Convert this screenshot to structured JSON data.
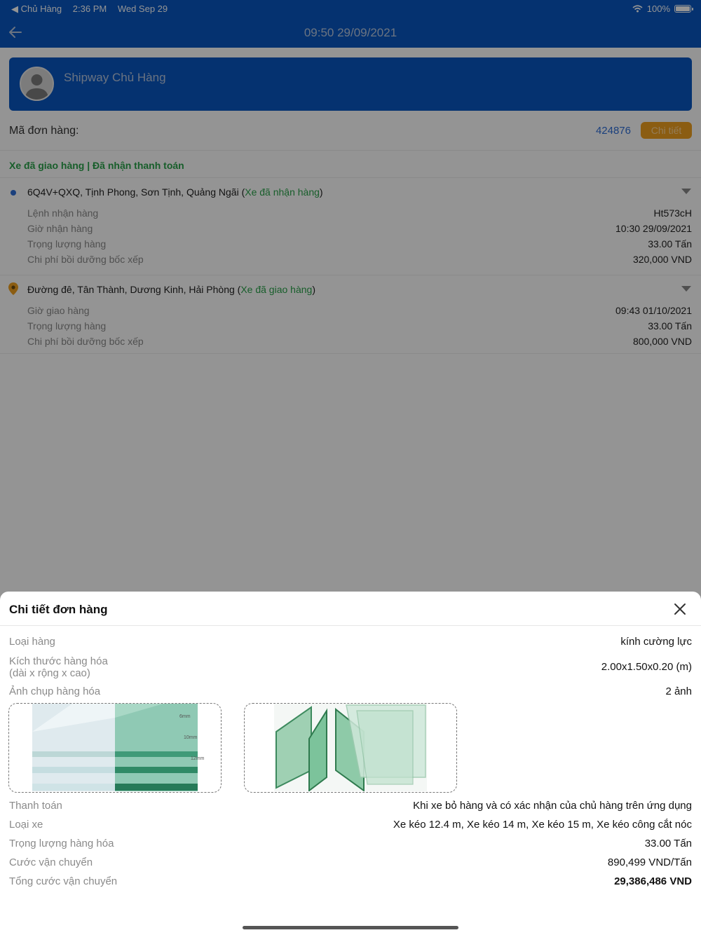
{
  "status_bar": {
    "back_app": "◀ Chủ Hàng",
    "time": "2:36 PM",
    "date": "Wed Sep 29",
    "battery": "100%"
  },
  "nav": {
    "title": "09:50 29/09/2021"
  },
  "shipper": {
    "name": "Shipway Chủ Hàng"
  },
  "order": {
    "label": "Mã đơn hàng:",
    "id": "424876",
    "detail_button": "Chi tiết"
  },
  "status": {
    "text": "Xe đã giao hàng | Đã nhận thanh toán"
  },
  "stops": [
    {
      "address": "6Q4V+QXQ, Tịnh Phong, Sơn Tịnh, Quảng Ngãi",
      "state": "Xe đã nhận hàng",
      "rows": [
        {
          "label": "Lệnh nhận hàng",
          "value": "Ht573cH"
        },
        {
          "label": "Giờ nhận hàng",
          "value": "10:30 29/09/2021"
        },
        {
          "label": "Trọng lượng hàng",
          "value": "33.00 Tấn"
        },
        {
          "label": "Chi phí bồi dưỡng bốc xếp",
          "value": "320,000 VND"
        }
      ]
    },
    {
      "address": "Đường đê, Tân Thành, Dương Kinh, Hải Phòng",
      "state": "Xe đã giao hàng",
      "rows": [
        {
          "label": "Giờ giao hàng",
          "value": "09:43 01/10/2021"
        },
        {
          "label": "Trọng lượng hàng",
          "value": "33.00 Tấn"
        },
        {
          "label": "Chi phí bồi dưỡng bốc xếp",
          "value": "800,000 VND"
        }
      ]
    }
  ],
  "sheet": {
    "title": "Chi tiết đơn hàng",
    "goods_type": {
      "label": "Loại hàng",
      "value": "kính cường lực"
    },
    "dimensions": {
      "label_line1": "Kích thước hàng hóa",
      "label_line2": "(dài x rộng x cao)",
      "value": "2.00x1.50x0.20 (m)"
    },
    "photos": {
      "label": "Ảnh chụp hàng hóa",
      "value": "2 ảnh"
    },
    "payment": {
      "label": "Thanh toán",
      "value": "Khi xe bỏ hàng và có xác nhận của chủ hàng trên ứng dụng"
    },
    "truck_type": {
      "label": "Loại xe",
      "value": "Xe kéo 12.4 m, Xe kéo 14 m, Xe kéo 15 m, Xe kéo công cắt nóc"
    },
    "weight": {
      "label": "Trọng lượng hàng hóa",
      "value": "33.00 Tấn"
    },
    "rate": {
      "label": "Cước vận chuyển",
      "value": "890,499 VND/Tấn"
    },
    "total": {
      "label": "Tổng cước vận chuyển",
      "value": "29,386,486 VND"
    }
  },
  "photo_marks": [
    "6mm",
    "10mm",
    "12mm"
  ],
  "colors": {
    "brand_blue": "#0a57c2",
    "status_green": "#2aa34a",
    "accent_orange": "#f0a020"
  }
}
